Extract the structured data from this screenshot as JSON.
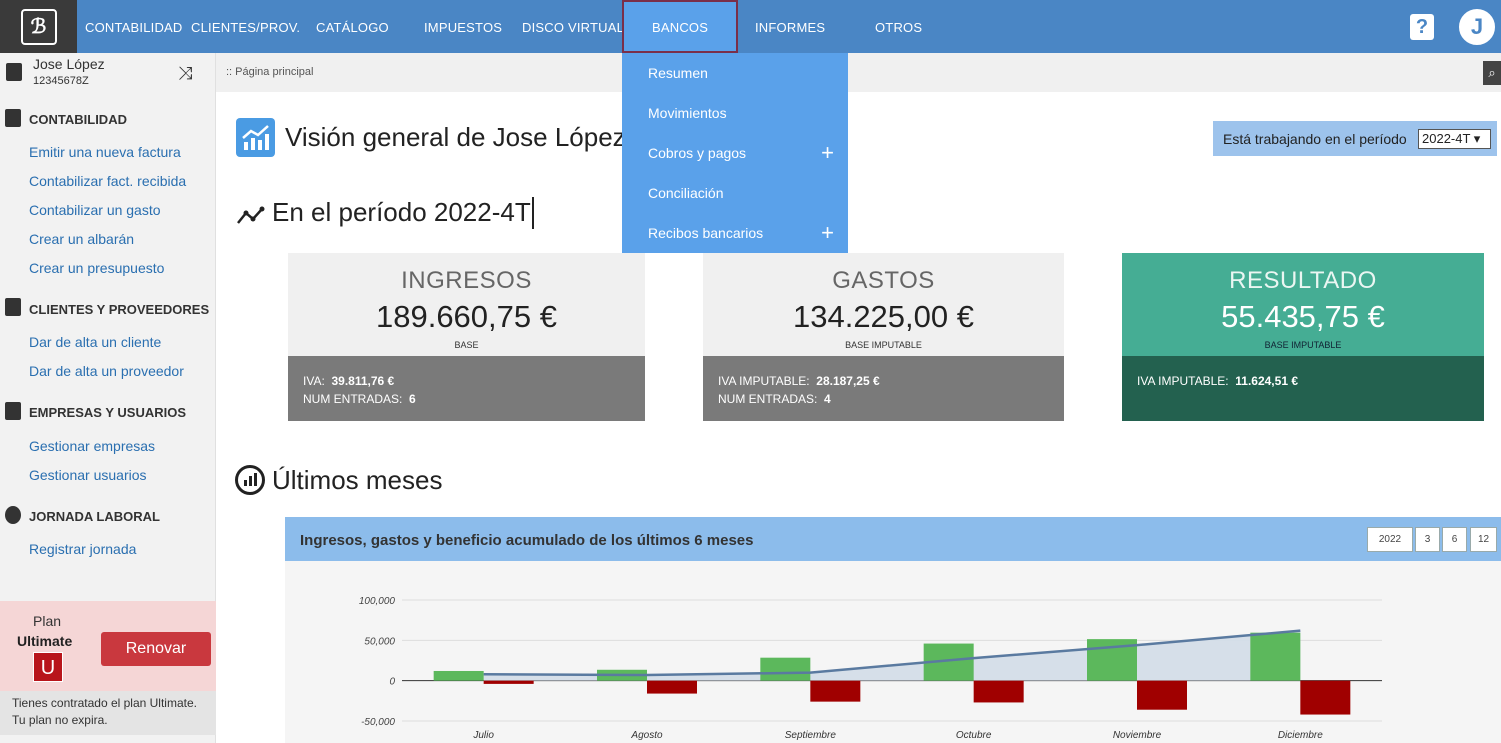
{
  "topbar": {
    "nav": [
      "CONTABILIDAD",
      "CLIENTES/PROV.",
      "CATÁLOGO",
      "IMPUESTOS",
      "DISCO VIRTUAL",
      "BANCOS",
      "INFORMES",
      "OTROS"
    ],
    "help": "?",
    "avatar": "J"
  },
  "dropdown": {
    "items": [
      "Resumen",
      "Movimientos",
      "Cobros y pagos",
      "Conciliación",
      "Recibos bancarios"
    ],
    "plus": "+"
  },
  "user": {
    "name": "Jose López",
    "id": "12345678Z"
  },
  "breadcrumb": ":: Página principal",
  "sidebar": {
    "sections": [
      {
        "title": "CONTABILIDAD",
        "links": [
          "Emitir una nueva factura",
          "Contabilizar fact. recibida",
          "Contabilizar un gasto",
          "Crear un albarán",
          "Crear un presupuesto"
        ]
      },
      {
        "title": "CLIENTES Y PROVEEDORES",
        "links": [
          "Dar de alta un cliente",
          "Dar de alta un proveedor"
        ]
      },
      {
        "title": "EMPRESAS Y USUARIOS",
        "links": [
          "Gestionar empresas",
          "Gestionar usuarios"
        ]
      },
      {
        "title": "JORNADA LABORAL",
        "links": [
          "Registrar jornada"
        ]
      }
    ],
    "plan_label": "Plan",
    "plan_name": "Ultimate",
    "plan_badge": "U",
    "renew": "Renovar",
    "plan_note_1": "Tienes contratado el plan Ultimate.",
    "plan_note_2": "Tu plan no expira."
  },
  "main": {
    "title": "Visión general de Jose López",
    "period_label": "Está trabajando en el período",
    "period_value": "2022-4T ▾",
    "subtitle": "En el período 2022-4T",
    "last_title": "Últimos meses"
  },
  "cards": [
    {
      "title": "INGRESOS",
      "value": "189.660,75 €",
      "sub": "BASE",
      "l1k": "IVA:",
      "l1v": "39.811,76 €",
      "l2k": "NUM ENTRADAS:",
      "l2v": "6"
    },
    {
      "title": "GASTOS",
      "value": "134.225,00 €",
      "sub": "BASE IMPUTABLE",
      "l1k": "IVA IMPUTABLE:",
      "l1v": "28.187,25 €",
      "l2k": "NUM ENTRADAS:",
      "l2v": "4"
    },
    {
      "title": "RESULTADO",
      "value": "55.435,75 €",
      "sub": "BASE IMPUTABLE",
      "l1k": "IVA IMPUTABLE:",
      "l1v": "11.624,51 €",
      "l2k": "",
      "l2v": ""
    }
  ],
  "chart_panel": {
    "title": "Ingresos, gastos y beneficio acumulado de los últimos 6 meses",
    "ranges": [
      "2022",
      "3",
      "6",
      "12"
    ]
  },
  "colors": {
    "income": "#5cb85c",
    "expense": "#a00000",
    "line": "#5a7aa0",
    "area": "#d3dde8",
    "result": "#45ad94",
    "result_dark": "#23614f"
  },
  "chart_data": {
    "type": "bar",
    "categories": [
      "Julio",
      "Agosto",
      "Septiembre",
      "Octubre",
      "Noviembre",
      "Diciembre"
    ],
    "ylim": [
      -50000,
      100000
    ],
    "yticks": [
      "100,000",
      "50,000",
      "0",
      "-50,000"
    ],
    "series": [
      {
        "values": [
          12000,
          13500,
          28500,
          46000,
          51500,
          59500
        ]
      },
      {
        "values": [
          -4000,
          -16000,
          -26000,
          -27000,
          -36000,
          -42000
        ]
      },
      {
        "type": "line",
        "values": [
          8000,
          7000,
          10000,
          28000,
          44000,
          62000
        ]
      }
    ]
  }
}
